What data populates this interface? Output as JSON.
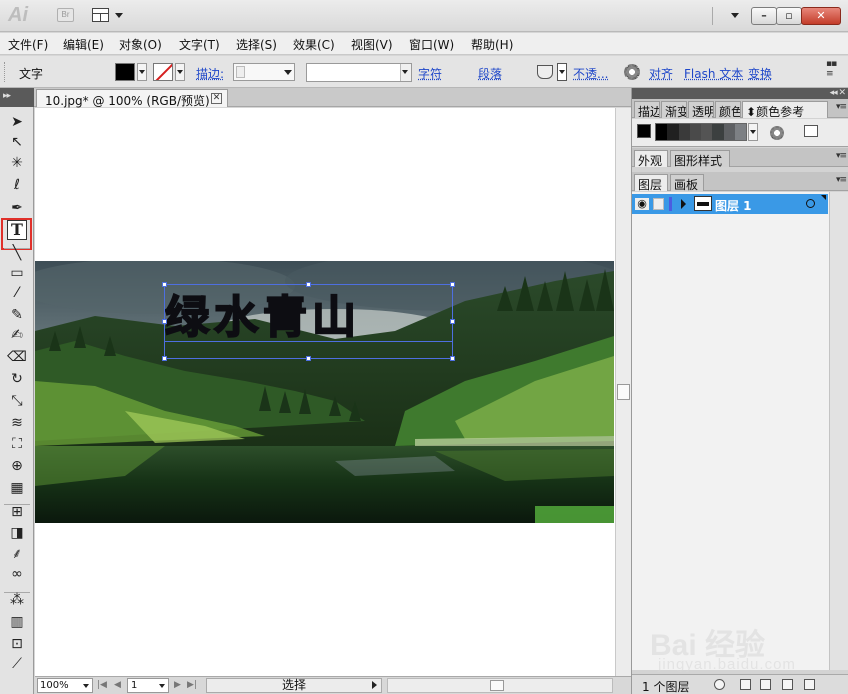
{
  "app": {
    "logo": "Ai",
    "bridge_label": "Br",
    "document_tab": "10.jpg* @ 100% (RGB/预览)"
  },
  "menu": [
    "文件(F)",
    "编辑(E)",
    "对象(O)",
    "文字(T)",
    "选择(S)",
    "效果(C)",
    "视图(V)",
    "窗口(W)",
    "帮助(H)"
  ],
  "control_bar": {
    "tool_label": "文字",
    "stroke_label": "描边:",
    "stroke_value": "",
    "style_value": "",
    "character_link": "字符",
    "paragraph_link": "段落",
    "opacity_link": "不透...",
    "align_link": "对齐",
    "flash_text_link": "Flash 文本",
    "transform_link": "变换",
    "fill_color": "#000000"
  },
  "canvas": {
    "headline_text": "绿水青山"
  },
  "tools": [
    "selection-tool",
    "direct-selection-tool",
    "magic-wand-tool",
    "lasso-tool",
    "pen-tool",
    "type-tool",
    "line-segment-tool",
    "rectangle-tool",
    "paintbrush-tool",
    "pencil-tool",
    "blob-brush-tool",
    "eraser-tool",
    "rotate-tool",
    "scale-tool",
    "warp-tool",
    "free-transform-tool",
    "shape-builder-tool",
    "perspective-grid-tool",
    "mesh-tool",
    "gradient-tool",
    "eyedropper-tool",
    "blend-tool",
    "symbol-sprayer-tool",
    "column-graph-tool",
    "artboard-tool",
    "slice-tool"
  ],
  "status_bar": {
    "zoom": "100%",
    "page": "1",
    "status_text": "选择"
  },
  "panels": {
    "top_tabs": [
      "描边",
      "渐变",
      "透明",
      "颜色",
      "颜色参考"
    ],
    "appearance_tabs": [
      "外观",
      "图形样式"
    ],
    "layers_tabs": [
      "图层",
      "画板"
    ],
    "layers": [
      {
        "name": "图层 1"
      }
    ],
    "layer_count": "1 个图层",
    "guide_colors": [
      "#000000",
      "#202020",
      "#3a3a3a",
      "#4a4a4a",
      "#545454",
      "#3c4040",
      "#5e6063",
      "#7d8084"
    ]
  },
  "watermark": {
    "logo": "Bai 经验",
    "url": "jingyan.baidu.com"
  }
}
